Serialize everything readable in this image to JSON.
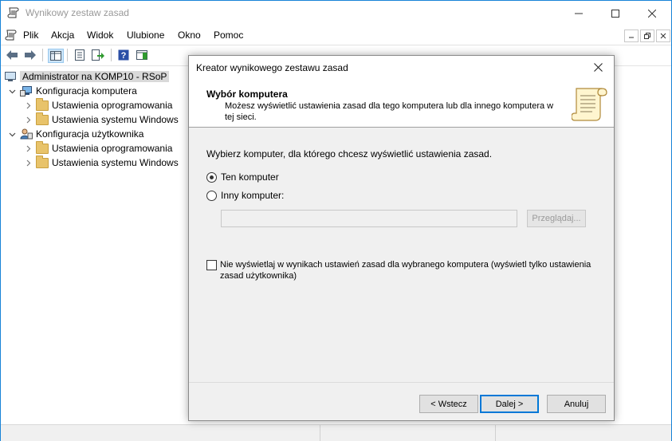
{
  "window": {
    "title": "Wynikowy zestaw zasad"
  },
  "menu": {
    "items": [
      "Plik",
      "Akcja",
      "Widok",
      "Ulubione",
      "Okno",
      "Pomoc"
    ]
  },
  "tree": {
    "root": "Administrator na KOMP10 - RSoP",
    "computer_config": "Konfiguracja komputera",
    "computer_children": [
      "Ustawienia oprogramowania",
      "Ustawienia systemu Windows"
    ],
    "user_config": "Konfiguracja użytkownika",
    "user_children": [
      "Ustawienia oprogramowania",
      "Ustawienia systemu Windows"
    ]
  },
  "dialog": {
    "title": "Kreator wynikowego zestawu zasad",
    "header_title": "Wybór komputera",
    "header_desc": "Możesz wyświetlić ustawienia zasad dla tego komputera lub dla innego komputera w tej sieci.",
    "prompt": "Wybierz komputer, dla którego chcesz wyświetlić ustawienia zasad.",
    "radio_this": "Ten komputer",
    "radio_other": "Inny komputer:",
    "selected_radio": "Ten komputer",
    "computer_input_value": "",
    "browse_label": "Przeglądaj...",
    "checkbox_label": "Nie wyświetlaj w wynikach ustawień zasad dla wybranego komputera (wyświetl tylko ustawienia zasad użytkownika)",
    "checkbox_checked": false,
    "back_label": "< Wstecz",
    "next_label": "Dalej >",
    "cancel_label": "Anuluj"
  }
}
